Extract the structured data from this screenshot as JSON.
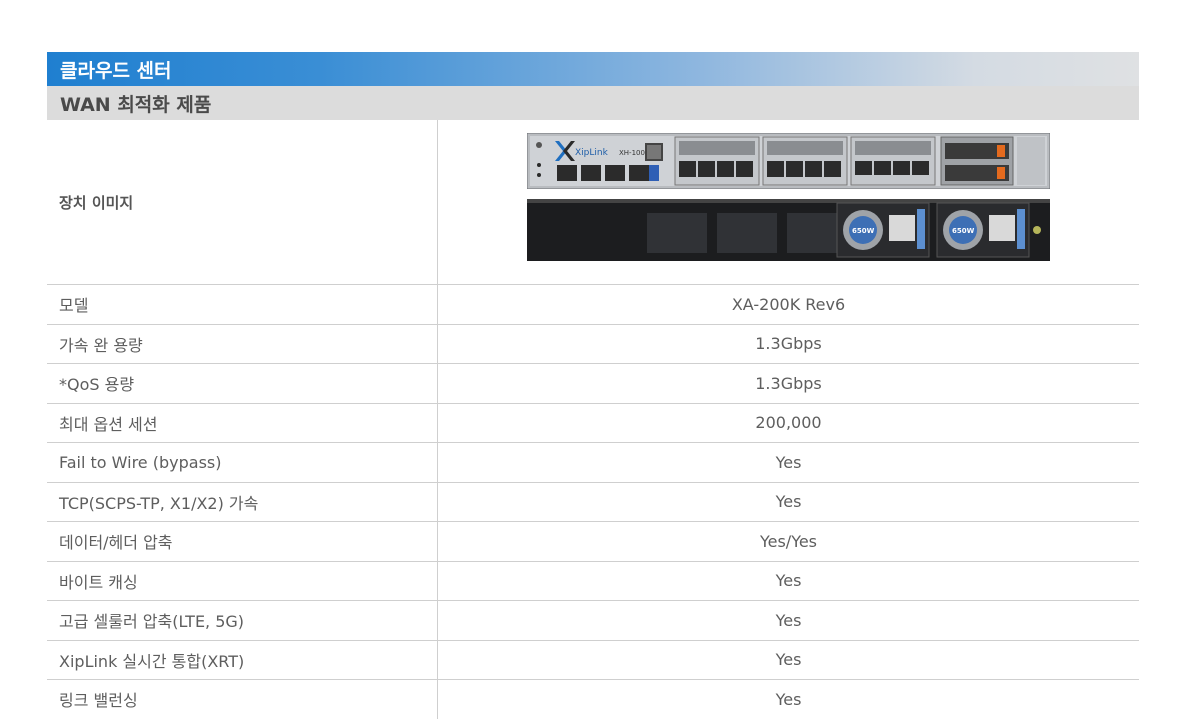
{
  "header": {
    "banner_title": "클라우드 센터",
    "section_title": "WAN 최적화 제품"
  },
  "image_row": {
    "label": "장치 이미지",
    "front_logo_text": "XipLink",
    "front_model_text": "XH-1000",
    "psu_badge": "650W"
  },
  "specs": [
    {
      "label": "모델",
      "value": "XA-200K Rev6"
    },
    {
      "label": "가속 완 용량",
      "value": "1.3Gbps"
    },
    {
      "label": "*QoS 용량",
      "value": "1.3Gbps"
    },
    {
      "label": "최대 옵션 세션",
      "value": "200,000"
    },
    {
      "label": "Fail to Wire (bypass)",
      "value": "Yes"
    },
    {
      "label": "TCP(SCPS-TP, X1/X2) 가속",
      "value": "Yes"
    },
    {
      "label": "데이터/헤더 압축",
      "value": "Yes/Yes"
    },
    {
      "label": "바이트 캐싱",
      "value": "Yes"
    },
    {
      "label": "고급 셀룰러 압축(LTE, 5G)",
      "value": "Yes"
    },
    {
      "label": "XipLink 실시간 통합(XRT)",
      "value": "Yes"
    },
    {
      "label": "링크 밸런싱",
      "value": "Yes"
    }
  ]
}
